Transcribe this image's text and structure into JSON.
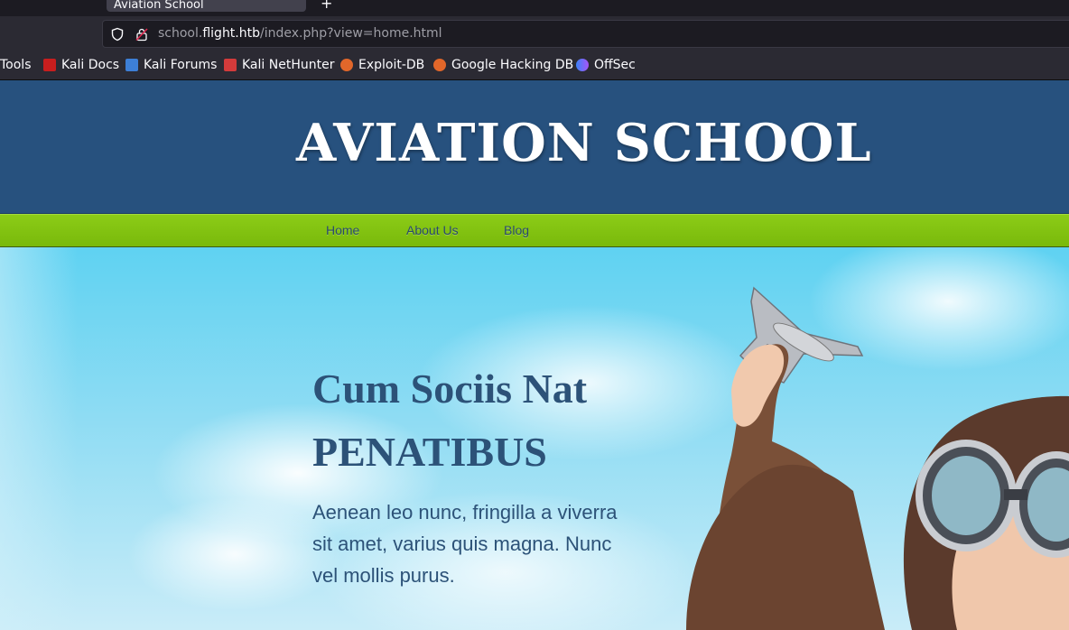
{
  "browser": {
    "tab_title": "Aviation School",
    "new_tab_glyph": "+",
    "url_prefix": "school.",
    "url_host": "flight.htb",
    "url_path": "/index.php?view=home.html",
    "bookmarks": [
      {
        "label": "Tools",
        "icon": "none"
      },
      {
        "label": "Kali Docs",
        "icon": "kali-docs-icon",
        "color": "#c81e1e"
      },
      {
        "label": "Kali Forums",
        "icon": "kali-forums-icon",
        "color": "#3d7fd6"
      },
      {
        "label": "Kali NetHunter",
        "icon": "kali-nethunter-icon",
        "color": "#d33b3b"
      },
      {
        "label": "Exploit-DB",
        "icon": "exploit-db-icon",
        "color": "#e2672a"
      },
      {
        "label": "Google Hacking DB",
        "icon": "google-hacking-db-icon",
        "color": "#e2672a"
      },
      {
        "label": "OffSec",
        "icon": "offsec-icon",
        "color": "#6a5acd"
      }
    ]
  },
  "site": {
    "title": "AVIATION SCHOOL",
    "header_color": "#27517e",
    "menu_color": "#7fbf0f",
    "menu": [
      {
        "label": "Home"
      },
      {
        "label": "About Us"
      },
      {
        "label": "Blog"
      }
    ],
    "hero": {
      "heading_line1": "Cum Sociis Nat",
      "heading_line2": "PENATIBUS",
      "text": "Aenean leo nunc, fringilla a viverra sit amet, varius quis magna. Nunc vel mollis purus.",
      "image": "boy-with-toy-airplane-and-goggles"
    }
  }
}
